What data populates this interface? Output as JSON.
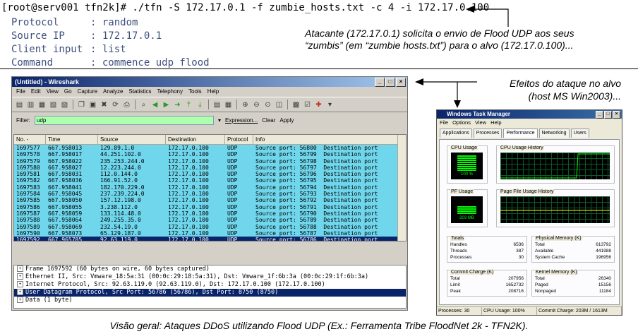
{
  "terminal": {
    "command_line": "[root@serv001 tfn2k]# ./tfn -S 172.17.0.1 -f zumbie_hosts.txt -c 4 -i 172.17.0.100",
    "fields": [
      {
        "key": "Protocol",
        "value": ": random"
      },
      {
        "key": "Source IP",
        "value": ": 172.17.0.1"
      },
      {
        "key": "Client input",
        "value": ": list"
      },
      {
        "key": "Command",
        "value": ": commence udp flood"
      }
    ]
  },
  "annotations": {
    "attacker_line1": "Atacante (172.17.0.1) solicita o envio de Flood UDP aos seus",
    "attacker_line2": "“zumbis” (em “zumbie  hosts.txt”) para o alvo (172.17.0.100)...",
    "effects_line1": "Efeitos do ataque no alvo",
    "effects_line2": "(host MS Win2003)...",
    "caption": "Visão geral: Ataques DDoS utilizando Flood UDP (Ex.: Ferramenta Tribe FloodNet 2k - TFN2K)."
  },
  "wireshark": {
    "title": "(Untitled) - Wireshark",
    "menu": [
      "File",
      "Edit",
      "View",
      "Go",
      "Capture",
      "Analyze",
      "Statistics",
      "Telephony",
      "Tools",
      "Help"
    ],
    "filter_label": "Filter:",
    "filter_value": "udp",
    "expression_label": "Expression...",
    "clear_label": "Clear",
    "apply_label": "Apply",
    "columns": [
      "No. -",
      "Time",
      "Source",
      "Destination",
      "Protocol",
      "Info"
    ],
    "packets": [
      [
        "1697577",
        "667.958013",
        "129.89.1.0",
        "172.17.0.100",
        "UDP",
        "Source port: 56800  Destination port"
      ],
      [
        "1697578",
        "667.958017",
        "44.251.102.0",
        "172.17.0.100",
        "UDP",
        "Source port: 56799  Destination port"
      ],
      [
        "1697579",
        "667.958022",
        "235.253.244.0",
        "172.17.0.100",
        "UDP",
        "Source port: 56798  Destination port"
      ],
      [
        "1697580",
        "667.958027",
        "12.223.244.0",
        "172.17.0.100",
        "UDP",
        "Source port: 56797  Destination port"
      ],
      [
        "1697581",
        "667.958031",
        "112.0.144.0",
        "172.17.0.100",
        "UDP",
        "Source port: 56796  Destination port"
      ],
      [
        "1697582",
        "667.958036",
        "166.91.52.0",
        "172.17.0.100",
        "UDP",
        "Source port: 56795  Destination port"
      ],
      [
        "1697583",
        "667.958041",
        "182.170.229.0",
        "172.17.0.100",
        "UDP",
        "Source port: 56794  Destination port"
      ],
      [
        "1697584",
        "667.958045",
        "237.239.224.0",
        "172.17.0.100",
        "UDP",
        "Source port: 56793  Destination port"
      ],
      [
        "1697585",
        "667.958050",
        "157.12.198.0",
        "172.17.0.100",
        "UDP",
        "Source port: 56792  Destination port"
      ],
      [
        "1697586",
        "667.958055",
        "3.238.112.0",
        "172.17.0.100",
        "UDP",
        "Source port: 56791  Destination port"
      ],
      [
        "1697587",
        "667.958059",
        "133.114.48.0",
        "172.17.0.100",
        "UDP",
        "Source port: 56790  Destination port"
      ],
      [
        "1697588",
        "667.958064",
        "249.255.35.0",
        "172.17.0.100",
        "UDP",
        "Source port: 56789  Destination port"
      ],
      [
        "1697589",
        "667.958069",
        "232.54.19.0",
        "172.17.0.100",
        "UDP",
        "Source port: 56788  Destination port"
      ],
      [
        "1697590",
        "667.958073",
        "65.129.187.0",
        "172.17.0.100",
        "UDP",
        "Source port: 56787  Destination port"
      ],
      [
        "1697592",
        "667.965785",
        "92.63.119.0",
        "172.17.0.100",
        "UDP",
        "Source port: 56786  Destination port"
      ]
    ],
    "details": [
      "Frame 1697592 (60 bytes on wire, 60 bytes captured)",
      "Ethernet II, Src: Vmware_18:5a:31 (00:0c:29:18:5a:31), Dst: Vmware_1f:6b:3a (00:0c:29:1f:6b:3a)",
      "Internet Protocol, Src: 92.63.119.0 (92.63.119.0), Dst: 172.17.0.100 (172.17.0.100)",
      "User Datagram Protocol, Src Port: 56786 (56786), Dst Port: 8750 (8750)",
      "Data (1 byte)"
    ]
  },
  "taskmgr": {
    "title": "Windows Task Manager",
    "menu": [
      "File",
      "Options",
      "View",
      "Help"
    ],
    "tabs": [
      "Applications",
      "Processes",
      "Performance",
      "Networking",
      "Users"
    ],
    "cpu_usage_label": "CPU Usage",
    "cpu_usage_value": "100 %",
    "cpu_history_label": "CPU Usage History",
    "pf_usage_label": "PF Usage",
    "pf_usage_value": "203 MB",
    "pf_history_label": "Page File Usage History",
    "totals": {
      "label": "Totals",
      "rows": [
        [
          "Handles",
          "6536"
        ],
        [
          "Threads",
          "387"
        ],
        [
          "Processes",
          "30"
        ]
      ]
    },
    "physical": {
      "label": "Physical Memory (K)",
      "rows": [
        [
          "Total",
          "613792"
        ],
        [
          "Available",
          "441988"
        ],
        [
          "System Cache",
          "196956"
        ]
      ]
    },
    "commit": {
      "label": "Commit Charge (K)",
      "rows": [
        [
          "Total",
          "207956"
        ],
        [
          "Limit",
          "1652732"
        ],
        [
          "Peak",
          "208716"
        ]
      ]
    },
    "kernel": {
      "label": "Kernel Memory (K)",
      "rows": [
        [
          "Total",
          "26340"
        ],
        [
          "Paged",
          "15156"
        ],
        [
          "Nonpaged",
          "11184"
        ]
      ]
    },
    "status": [
      "Processes: 30",
      "CPU Usage: 100%",
      "Commit Charge: 203M / 1613M"
    ]
  }
}
